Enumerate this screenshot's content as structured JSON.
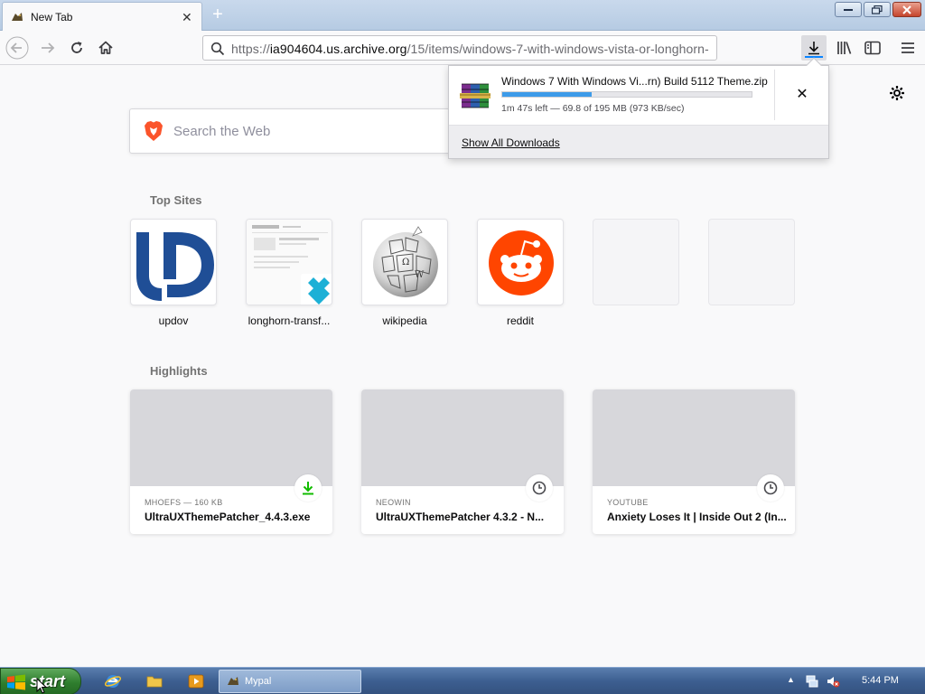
{
  "browser": {
    "tab": {
      "title": "New Tab"
    },
    "url": {
      "prefix": "https://",
      "host": "ia904604.us.archive.org",
      "path": "/15/items/windows-7-with-windows-vista-or-longhorn-"
    }
  },
  "newtab": {
    "search_placeholder": "Search the Web",
    "top_sites_title": "Top Sites",
    "top_sites": [
      {
        "label": "updov"
      },
      {
        "label": "longhorn-transf..."
      },
      {
        "label": "wikipedia"
      },
      {
        "label": "reddit"
      },
      {
        "label": ""
      },
      {
        "label": ""
      }
    ],
    "highlights_title": "Highlights",
    "highlights": [
      {
        "source": "MHOEFS — 160 KB",
        "title": "UltraUXThemePatcher_4.4.3.exe",
        "badge": "download-icon"
      },
      {
        "source": "NEOWIN",
        "title": "UltraUXThemePatcher 4.3.2 - N...",
        "badge": "clock-icon"
      },
      {
        "source": "YOUTUBE",
        "title": "Anxiety Loses It | Inside Out 2 (In...",
        "badge": "clock-icon"
      }
    ]
  },
  "downloads": {
    "item": {
      "filename": "Windows 7 With Windows Vi...rn) Build 5112 Theme.zip",
      "progress": 0.36,
      "status": "1m 47s left — 69.8 of 195 MB (973 KB/sec)",
      "cancel": "✕"
    },
    "footer": "Show All Downloads"
  },
  "taskbar": {
    "start": "start",
    "task_label": "Mypal",
    "clock": "5:44 PM"
  },
  "colors": {
    "accent": "#0a84ff",
    "progress": "#3d9be9",
    "reddit": "#ff4500",
    "updov": "#1f4e96",
    "download_badge": "#12bc00"
  }
}
